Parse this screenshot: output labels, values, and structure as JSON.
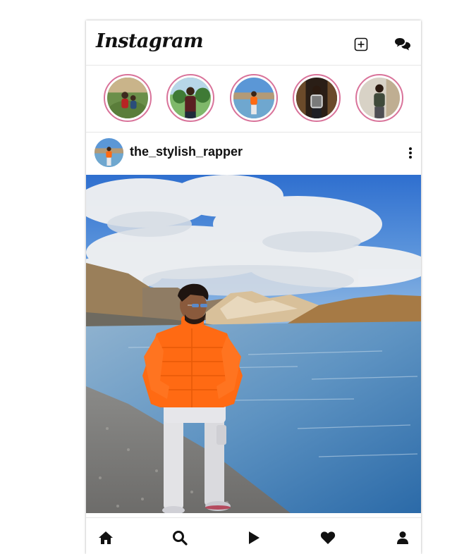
{
  "app": {
    "logo_text": "Instagram"
  },
  "header": {
    "icons": [
      "add-post-icon",
      "messages-icon"
    ]
  },
  "stories": [
    {
      "name": "story-1"
    },
    {
      "name": "story-2"
    },
    {
      "name": "story-3"
    },
    {
      "name": "story-4"
    },
    {
      "name": "story-5"
    }
  ],
  "post": {
    "username": "the_stylish_rapper"
  },
  "bottom_nav": {
    "items": [
      "home-icon",
      "search-icon",
      "reels-icon",
      "heart-icon",
      "profile-icon"
    ]
  },
  "colors": {
    "story_ring": "#d9739a",
    "text": "#111111",
    "border": "#e6e6e6",
    "jacket": "#ff6a13",
    "sky": "#4a86d8"
  }
}
